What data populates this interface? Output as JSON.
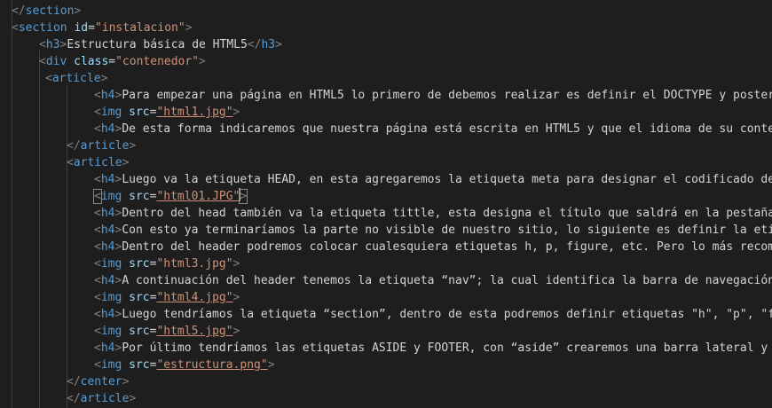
{
  "editor": {
    "colors": {
      "background": "#1e1e1e",
      "tag": "#569cd6",
      "bracket": "#808080",
      "attr": "#9cdcfe",
      "string": "#ce9178",
      "text": "#d4d4d4"
    },
    "lines": [
      {
        "open": "</",
        "tag": "section",
        "close": ">"
      },
      {
        "open": "<",
        "tag": "section",
        "attr": "id",
        "value": "\"instalacion\"",
        "close": ">"
      },
      {
        "open": "<",
        "tag": "h3",
        "close": ">",
        "text": "Estructura básica de HTML5",
        "end_open": "</",
        "end_tag": "h3",
        "end_close": ">"
      },
      {
        "open": "<",
        "tag": "div",
        "attr": "class",
        "value": "\"contenedor\"",
        "close": ">"
      },
      {
        "open": "<",
        "tag": "article",
        "close": ">"
      },
      {
        "open": "<",
        "tag": "h4",
        "close": ">",
        "text": "Para empezar una página en HTML5 lo primero de debemos realizar es definir el DOCTYPE y posterio"
      },
      {
        "open": "<",
        "tag": "img",
        "attr": "src",
        "value": "\"html1.jpg\"",
        "close": ">"
      },
      {
        "open": "<",
        "tag": "h4",
        "close": ">",
        "text": "De esta forma indicaremos que nuestra página está escrita en HTML5 y que el idioma de su conteni"
      },
      {
        "open": "</",
        "tag": "article",
        "close": ">"
      },
      {
        "open": "<",
        "tag": "article",
        "close": ">"
      },
      {
        "open": "<",
        "tag": "h4",
        "close": ">",
        "text": "Luego va la etiqueta HEAD, en esta agregaremos la etiqueta meta para designar el codificado de n"
      },
      {
        "open": "<",
        "tag": "img",
        "attr": "src",
        "value": "\"html01.JPG\"",
        "close": ">"
      },
      {
        "open": "<",
        "tag": "h4",
        "close": ">",
        "text": "Dentro del head también va la etiqueta tittle, esta designa el título que saldrá en la pestaña s"
      },
      {
        "open": "<",
        "tag": "h4",
        "close": ">",
        "text": "Con esto ya terminaríamos la parte no visible de nuestro sitio, lo siguiente es definir la etiqu"
      },
      {
        "open": "<",
        "tag": "h4",
        "close": ">",
        "text": "Dentro del header podremos colocar cualesquiera etiquetas h, p, figure, etc. Pero lo más recomen"
      },
      {
        "open": "<",
        "tag": "img",
        "attr": "src",
        "value": "\"html3.jpg\"",
        "close": ">"
      },
      {
        "open": "<",
        "tag": "h4",
        "close": ">",
        "text": "A continuación del header tenemos la etiqueta “nav”; la cual identifica la barra de navegación c"
      },
      {
        "open": "<",
        "tag": "img",
        "attr": "src",
        "value": "\"html4.jpg\"",
        "close": ">"
      },
      {
        "open": "<",
        "tag": "h4",
        "close": ">",
        "text": "Luego tendríamos la etiqueta “section”, dentro de esta podremos definir etiquetas \"h\", \"p\", \"fig"
      },
      {
        "open": "<",
        "tag": "img",
        "attr": "src",
        "value": "\"html5.jpg\"",
        "close": ">"
      },
      {
        "open": "<",
        "tag": "h4",
        "close": ">",
        "text": "Por último tendríamos las etiquetas ASIDE y FOOTER, con “aside” crearemos una barra lateral y co"
      },
      {
        "open": "<",
        "tag": "img",
        "attr": "src",
        "value": "\"estructura.png\"",
        "close": ">"
      },
      {
        "open": "</",
        "tag": "center",
        "close": ">"
      },
      {
        "open": "</",
        "tag": "article",
        "close": ">"
      }
    ]
  }
}
